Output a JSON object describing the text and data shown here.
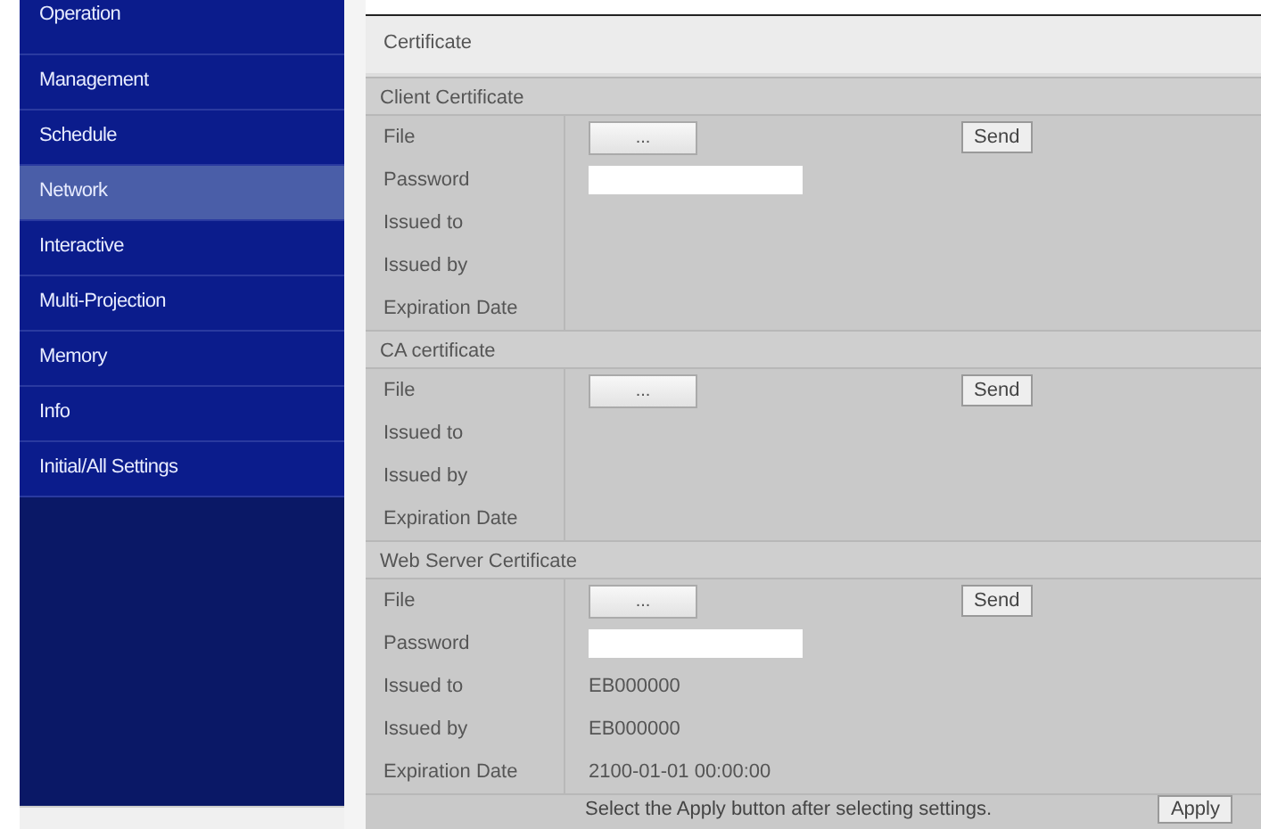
{
  "sidebar": {
    "items": [
      {
        "label": "Operation",
        "selected": false
      },
      {
        "label": "Management",
        "selected": false
      },
      {
        "label": "Schedule",
        "selected": false
      },
      {
        "label": "Network",
        "selected": true
      },
      {
        "label": "Interactive",
        "selected": false
      },
      {
        "label": "Multi-Projection",
        "selected": false
      },
      {
        "label": "Memory",
        "selected": false
      },
      {
        "label": "Info",
        "selected": false
      },
      {
        "label": "Initial/All Settings",
        "selected": false
      }
    ]
  },
  "page_title": "Certificate",
  "sections": [
    {
      "title": "Client Certificate",
      "rows": [
        {
          "kind": "file",
          "label": "File",
          "button": "...",
          "send": "Send"
        },
        {
          "kind": "password",
          "label": "Password"
        },
        {
          "kind": "text",
          "label": "Issued to"
        },
        {
          "kind": "text",
          "label": "Issued by"
        },
        {
          "kind": "text",
          "label": "Expiration Date"
        }
      ]
    },
    {
      "title": "CA certificate",
      "rows": [
        {
          "kind": "file",
          "label": "File",
          "button": "...",
          "send": "Send"
        },
        {
          "kind": "text",
          "label": "Issued to"
        },
        {
          "kind": "text",
          "label": "Issued by"
        },
        {
          "kind": "text",
          "label": "Expiration Date"
        }
      ]
    },
    {
      "title": "Web Server Certificate",
      "rows": [
        {
          "kind": "file",
          "label": "File",
          "button": "...",
          "send": "Send"
        },
        {
          "kind": "password",
          "label": "Password"
        },
        {
          "kind": "text",
          "label": "Issued to",
          "value": "EB000000"
        },
        {
          "kind": "text",
          "label": "Issued by",
          "value": "EB000000"
        },
        {
          "kind": "text",
          "label": "Expiration Date",
          "value": "2100-01-01 00:00:00"
        }
      ]
    }
  ],
  "footer": {
    "message": "Select the Apply button after selecting settings.",
    "button": "Apply"
  }
}
